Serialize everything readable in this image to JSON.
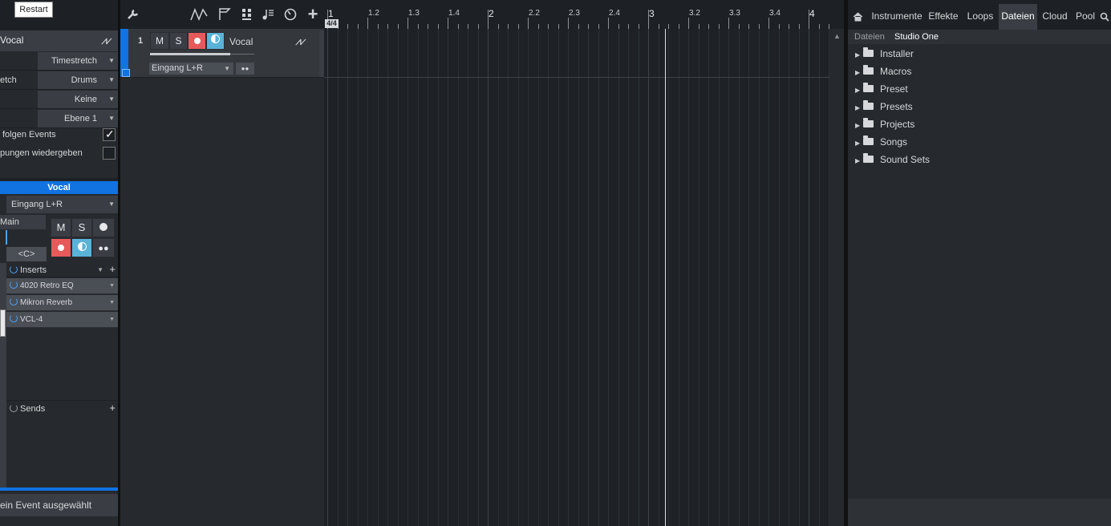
{
  "tooltip": "Restart",
  "inspector": {
    "track_name": "Vocal",
    "rows": [
      {
        "left": "",
        "value": "Timestretch"
      },
      {
        "left": "etch",
        "value": "Drums"
      },
      {
        "left": "",
        "value": "Keine"
      },
      {
        "left": "",
        "value": "Ebene 1"
      }
    ],
    "follow_events_label": "folgen Events",
    "follow_events_checked": true,
    "play_overlaps_label": "pungen wiedergeben",
    "play_overlaps_checked": false
  },
  "channel": {
    "name": "Vocal",
    "input": "Eingang L+R",
    "output": "Main",
    "mute": "M",
    "solo": "S",
    "pan": "<C>",
    "inserts_label": "Inserts",
    "inserts": [
      "4020 Retro EQ",
      "Mikron Reverb",
      "VCL-4"
    ],
    "sends_label": "Sends",
    "status": "ein Event ausgewählt"
  },
  "track": {
    "number": "1",
    "mute": "M",
    "solo": "S",
    "name": "Vocal",
    "input": "Eingang L+R"
  },
  "ruler": {
    "time_signature": "4/4",
    "labels": [
      "1",
      "1.2",
      "1.3",
      "1.4",
      "2",
      "2.2",
      "2.3",
      "2.4",
      "3",
      "3.2",
      "3.3",
      "3.4",
      "4"
    ]
  },
  "browser": {
    "tabs": [
      "Instrumente",
      "Effekte",
      "Loops",
      "Dateien",
      "Cloud",
      "Pool"
    ],
    "active_tab": "Dateien",
    "breadcrumb": [
      "Dateien",
      "Studio One"
    ],
    "folders": [
      "Installer",
      "Macros",
      "Preset",
      "Presets",
      "Projects",
      "Songs",
      "Sound Sets"
    ]
  },
  "icons": {
    "home": "home-icon",
    "search": "search-icon",
    "wrench": "wrench-icon",
    "add": "plus-icon"
  }
}
